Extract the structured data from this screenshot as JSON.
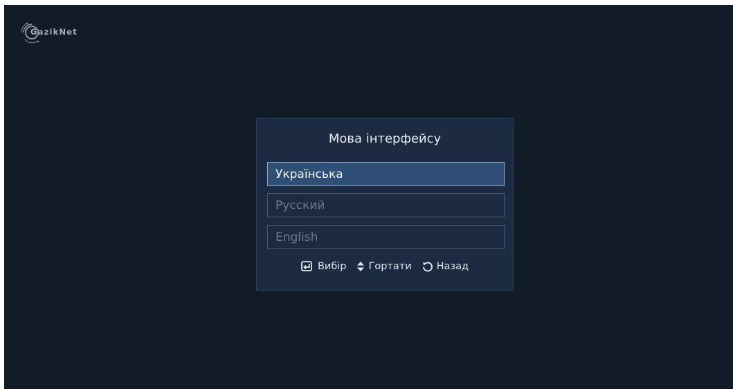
{
  "app": {
    "logo_text": "GazikNet"
  },
  "dialog": {
    "title": "Мова інтерфейсу",
    "options": [
      {
        "label": "Українська",
        "selected": true
      },
      {
        "label": "Русский",
        "selected": false
      },
      {
        "label": "English",
        "selected": false
      }
    ]
  },
  "hints": {
    "select_icon": "enter-icon",
    "select_label": "Вибір",
    "scroll_icon": "up-down-icon",
    "scroll_label": "Гортати",
    "back_icon": "back-arrow-icon",
    "back_label": "Назад"
  },
  "colors": {
    "background": "#121b28",
    "dialog_bg": "#1c2b41",
    "selected_bg": "#2f4f76",
    "selected_border": "#8fa8c4"
  }
}
